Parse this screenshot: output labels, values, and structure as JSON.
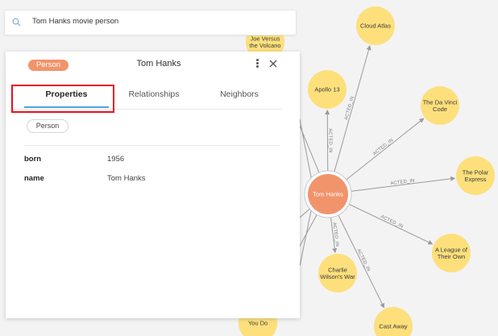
{
  "search": {
    "query": "Tom Hanks movie person"
  },
  "panel": {
    "badge": "Person",
    "title": "Tom Hanks",
    "tabs": [
      "Properties",
      "Relationships",
      "Neighbors"
    ],
    "active_tab": "Properties",
    "label_pill": "Person",
    "properties": [
      {
        "key": "born",
        "value": "1956"
      },
      {
        "key": "name",
        "value": "Tom Hanks"
      }
    ]
  },
  "graph": {
    "center": {
      "label": "Tom Hanks",
      "color": "#f1946c"
    },
    "node_color": "#fde07c",
    "edge_label": "ACTED_IN",
    "movies": [
      {
        "label": [
          "Cloud Atlas"
        ]
      },
      {
        "label": [
          "Apollo 13"
        ]
      },
      {
        "label": [
          "The Da Vinci",
          "Code"
        ]
      },
      {
        "label": [
          "The Polar",
          "Express"
        ]
      },
      {
        "label": [
          "A League of",
          "Their Own"
        ]
      },
      {
        "label": [
          "Cast Away"
        ]
      },
      {
        "label": [
          "Charlie",
          "Wilson's War"
        ]
      },
      {
        "label": [
          "Joe Versus",
          "the Volcano"
        ]
      },
      {
        "label": [
          "You Do"
        ]
      }
    ]
  },
  "colors": {
    "accent": "#4aa3df",
    "highlight": "#e8101b",
    "badge": "#f1946c"
  }
}
